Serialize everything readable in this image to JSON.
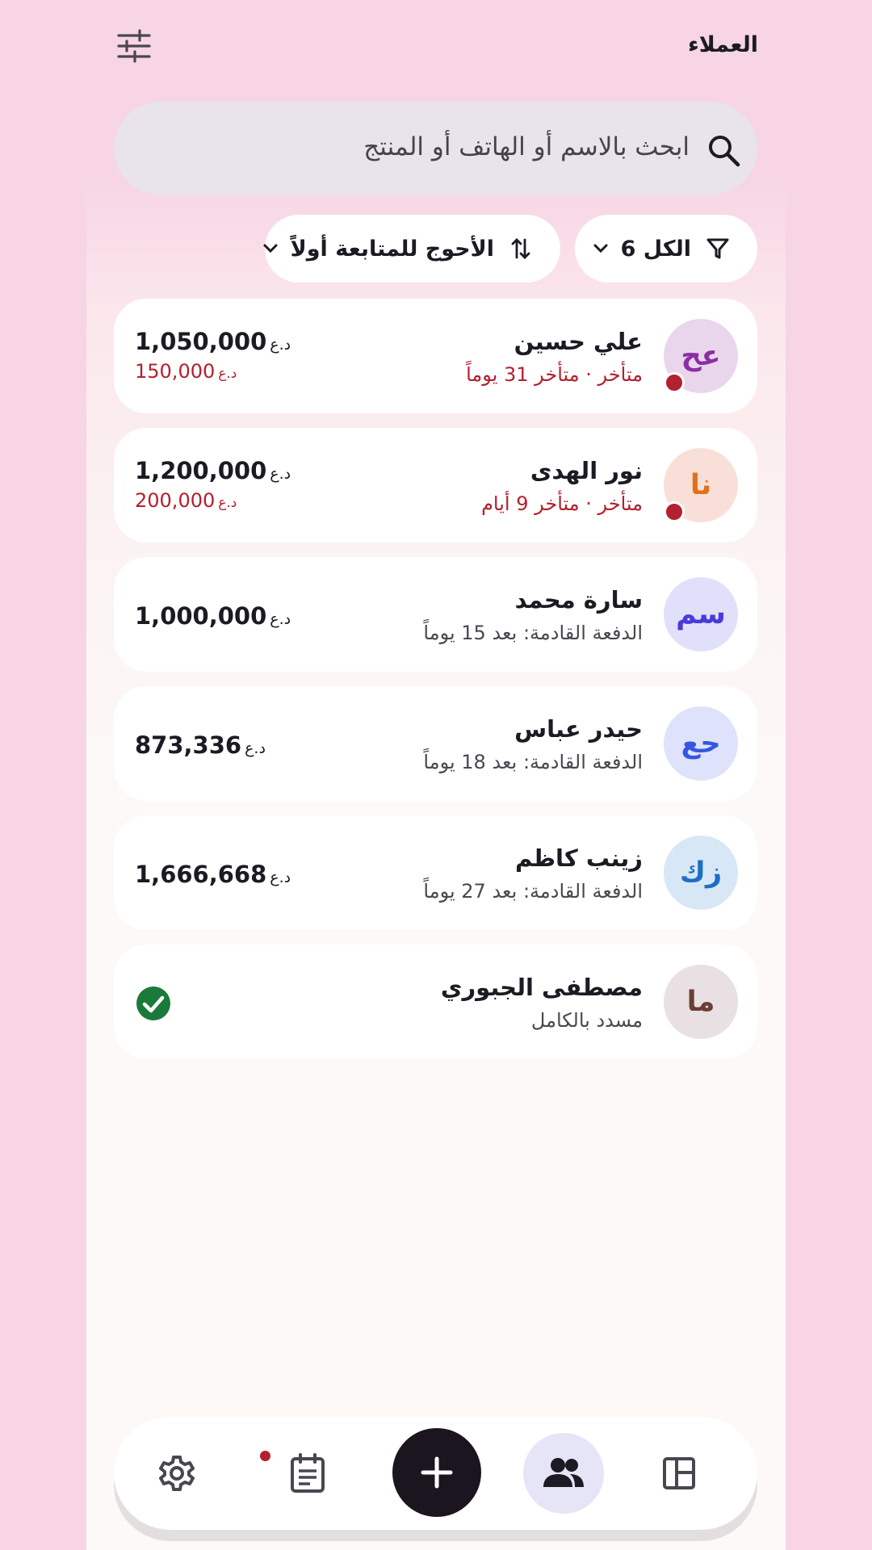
{
  "header": {
    "title": "العملاء",
    "settings_icon": "tune-icon"
  },
  "search": {
    "placeholder": "ابحث بالاسم أو الهاتف أو المنتج"
  },
  "filters": {
    "filter_chip": {
      "label": "الكل 6",
      "icon": "filter-icon"
    },
    "sort_chip": {
      "label": "الأحوج للمتابعة أولاً",
      "icon": "sort-icon"
    }
  },
  "currency": "د.ع",
  "customers": [
    {
      "initials": "عح",
      "name": "علي حسين",
      "status": "متأخر · متأخر 31 يوماً",
      "late": true,
      "amount": "1,050,000",
      "overdue": "150,000",
      "avatar_bg": "#ead6ec",
      "avatar_fg": "#8a2fa3"
    },
    {
      "initials": "نا",
      "name": "نور الهدى",
      "status": "متأخر · متأخر 9 أيام",
      "late": true,
      "amount": "1,200,000",
      "overdue": "200,000",
      "avatar_bg": "#f8e0d8",
      "avatar_fg": "#e0711a"
    },
    {
      "initials": "سم",
      "name": "سارة محمد",
      "status": "الدفعة القادمة: بعد 15 يوماً",
      "late": false,
      "amount": "1,000,000",
      "avatar_bg": "#e1e0fb",
      "avatar_fg": "#4a3ad9"
    },
    {
      "initials": "حع",
      "name": "حيدر عباس",
      "status": "الدفعة القادمة: بعد 18 يوماً",
      "late": false,
      "amount": "873,336",
      "avatar_bg": "#dfe2fb",
      "avatar_fg": "#3456e0"
    },
    {
      "initials": "زك",
      "name": "زينب كاظم",
      "status": "الدفعة القادمة: بعد 27 يوماً",
      "late": false,
      "amount": "1,666,668",
      "avatar_bg": "#d8e7f6",
      "avatar_fg": "#1c6fc4"
    },
    {
      "initials": "ما",
      "name": "مصطفى الجبوري",
      "status": "مسدد بالكامل",
      "late": false,
      "paid": true,
      "avatar_bg": "#e8e0e2",
      "avatar_fg": "#6b3d36"
    }
  ],
  "colors": {
    "late": "#b3202e",
    "paid": "#1b7a3a",
    "fab": "#1b1520"
  },
  "nav": [
    {
      "icon": "dashboard-icon"
    },
    {
      "icon": "customers-icon",
      "selected": true
    },
    {
      "icon": "add-icon"
    },
    {
      "icon": "calendar-notes-icon",
      "badge": true
    },
    {
      "icon": "settings-icon"
    }
  ]
}
